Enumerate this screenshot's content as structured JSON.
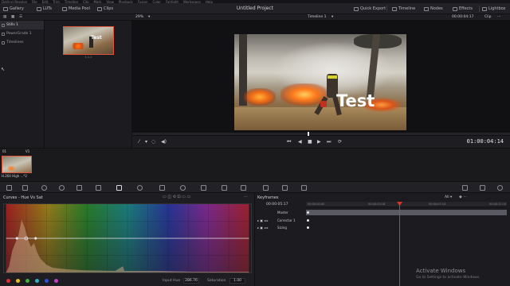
{
  "menu": {
    "items": [
      "DaVinci Resolve",
      "File",
      "Edit",
      "Trim",
      "Timeline",
      "Clip",
      "Mark",
      "View",
      "Playback",
      "Fusion",
      "Color",
      "Fairlight",
      "Workspace",
      "Help"
    ]
  },
  "toolbar": {
    "gallery": "Gallery",
    "luts": "LUTs",
    "media_pool": "Media Pool",
    "clips": "Clips",
    "project_title": "Untitled Project",
    "quick_export": "Quick Export",
    "timeline": "Timeline",
    "nodes": "Nodes",
    "effects": "Effects",
    "lightbox": "Lightbox"
  },
  "subbar": {
    "zoom": "29%",
    "timeline_name": "Timeline 1",
    "timecode": "00:00:04:17",
    "clip_mode": "Clip"
  },
  "gallery": {
    "albums": [
      {
        "label": "Stills 1",
        "active": true
      },
      {
        "label": "PowerGrade 1",
        "active": false
      },
      {
        "label": "Timelines",
        "active": false
      }
    ],
    "still_label": "1.1.1",
    "still_overlay": "Test"
  },
  "viewer": {
    "overlay_text": "Test",
    "timecode": "01:00:04:14"
  },
  "clips": {
    "items": [
      {
        "number": "01",
        "track": "V1",
        "name": "H.264 High ...",
        "suffix": "*2"
      }
    ]
  },
  "curves": {
    "title": "Curves - Hue Vs Sat",
    "input_hue_label": "Input Hue",
    "input_hue_value": "286.76",
    "saturation_label": "Saturation",
    "saturation_value": "1.00",
    "swatch_colors": [
      "#d93030",
      "#e0c020",
      "#40b040",
      "#30b0c0",
      "#3050d0",
      "#c040c0"
    ]
  },
  "keyframes": {
    "title": "Keyframes",
    "filter": "All",
    "current_tc": "00:00:05:17",
    "ruler": [
      "00:00:00:00",
      "00:00:03:18",
      "00:00:07:14",
      "00:00:11:10"
    ],
    "rows": [
      {
        "label": "Master"
      },
      {
        "label": "Corrector 1"
      },
      {
        "label": "Sizing"
      }
    ]
  },
  "watermark": {
    "line1": "Activate Windows",
    "line2": "Go to Settings to activate Windows."
  }
}
